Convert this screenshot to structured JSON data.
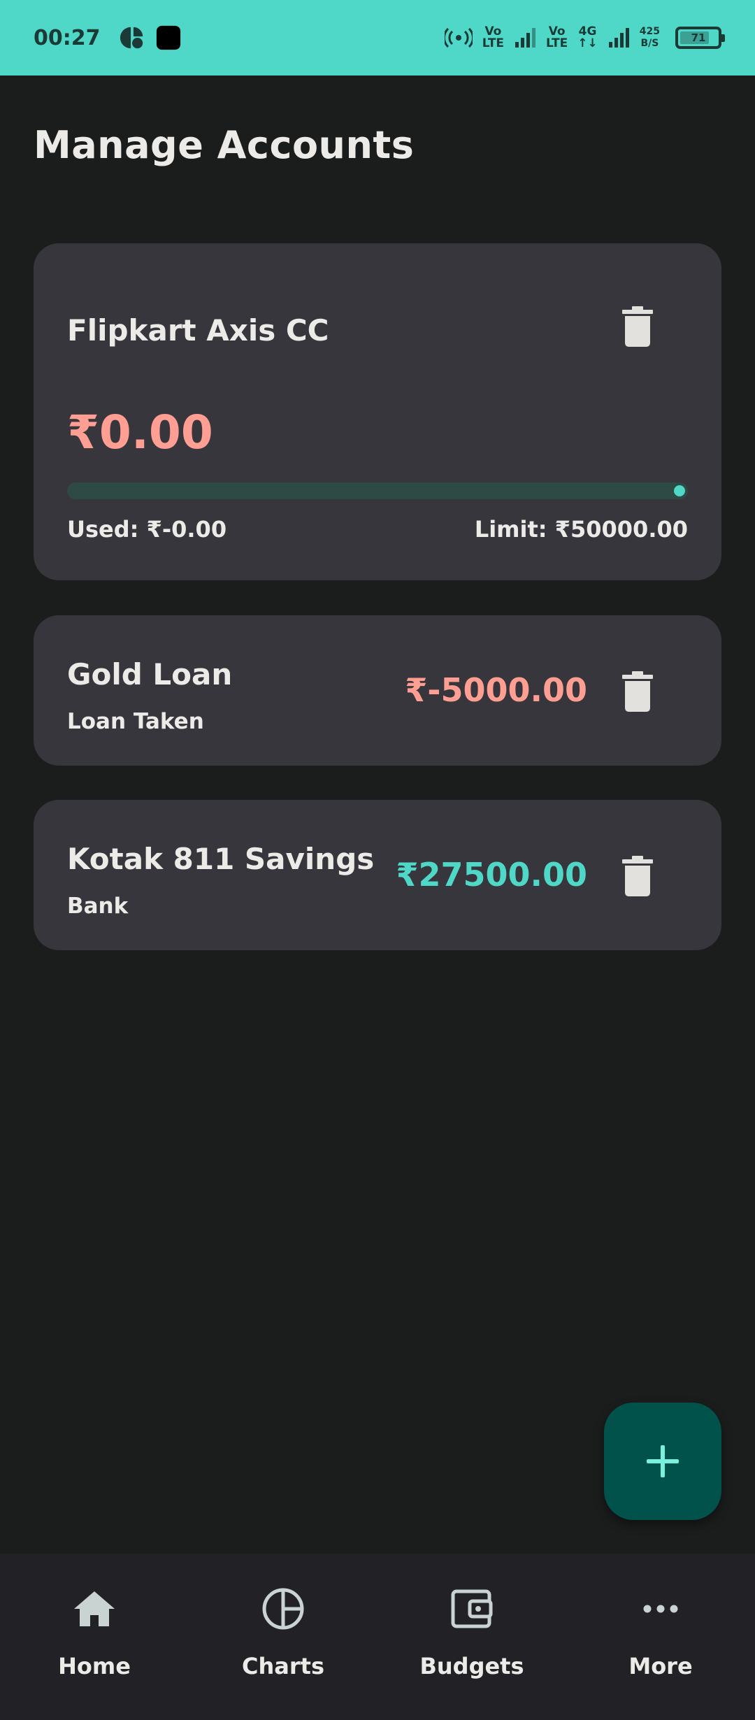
{
  "status_bar": {
    "time": "00:27",
    "volte1_top": "Vo",
    "volte1_bottom": "LTE",
    "volte2_top": "Vo",
    "volte2_bottom": "LTE",
    "network_type": "4G",
    "speed_top": "425",
    "speed_bottom": "B/S",
    "battery_level": "71",
    "background_color": "#4fd8c8"
  },
  "page": {
    "title": "Manage Accounts"
  },
  "accounts": [
    {
      "name": "Flipkart Axis CC",
      "balance": "₹0.00",
      "used_label": "Used: ₹-0.00",
      "limit_label": "Limit: ₹50000.00",
      "progress_fraction": 1.0
    },
    {
      "name": "Gold Loan",
      "type": "Loan Taken",
      "balance": "₹-5000.00"
    },
    {
      "name": "Kotak 811 Savings",
      "type": "Bank",
      "balance": "₹27500.00"
    }
  ],
  "icons": {
    "delete": "trash-icon",
    "add": "plus-icon",
    "home": "home-icon",
    "charts": "pie-chart-icon",
    "budgets": "wallet-icon",
    "more": "more-horiz-icon"
  },
  "colors": {
    "negative": "#ff9e92",
    "positive": "#4fd8c8",
    "card": "#38363d",
    "fab": "#00524b"
  },
  "nav": {
    "home": "Home",
    "charts": "Charts",
    "budgets": "Budgets",
    "more": "More"
  }
}
